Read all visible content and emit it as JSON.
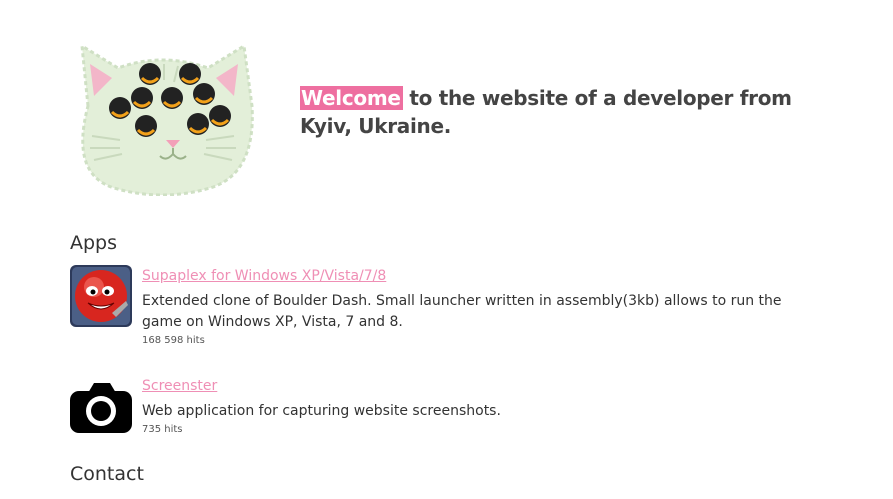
{
  "header": {
    "logo_icon": "seven-eyed-cat-logo-icon",
    "tagline_highlight": "Welcome",
    "tagline_rest": " to the website of a developer from Kyiv, Ukraine.",
    "highlight_color": "#ee6fa0"
  },
  "apps": {
    "heading": "Apps",
    "items": [
      {
        "icon": "supaplex-murphy-icon",
        "title": "Supaplex for Windows XP/Vista/7/8",
        "description": "Extended clone of Boulder Dash. Small launcher written in assembly(3kb) allows to run the game on Windows XP, Vista, 7 and 8.",
        "hits": "168 598 hits"
      },
      {
        "icon": "camera-icon",
        "title": "Screenster",
        "description": "Web application for capturing website screenshots.",
        "hits": "735 hits"
      }
    ]
  },
  "contact": {
    "heading": "Contact"
  },
  "colors": {
    "link": "#ef8fb5",
    "text": "#333333"
  }
}
